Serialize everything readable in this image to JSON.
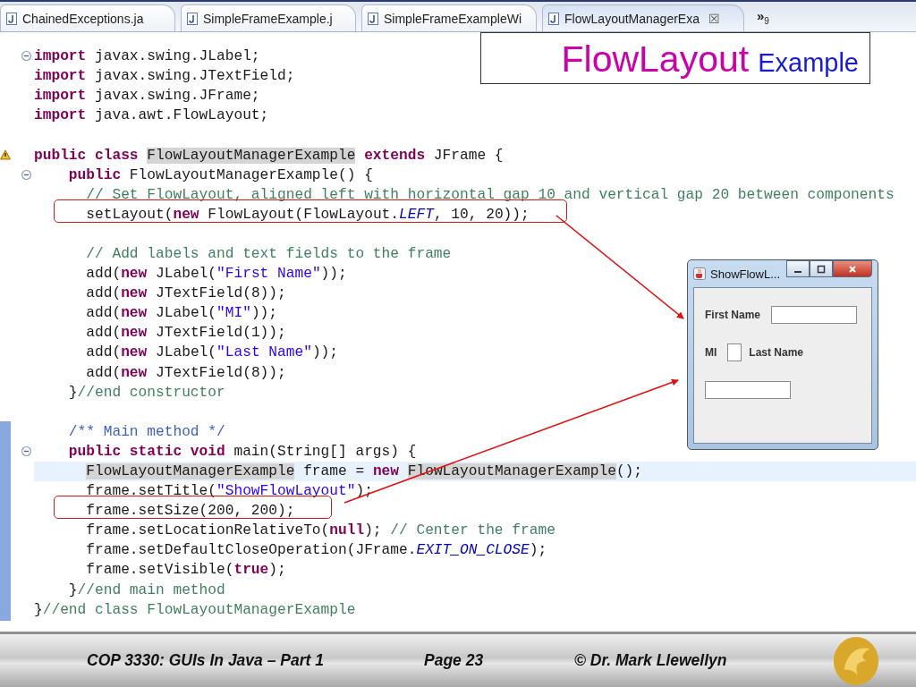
{
  "tabs": [
    {
      "label": "ChainedExceptions.ja",
      "selected": false
    },
    {
      "label": "SimpleFrameExample.j",
      "selected": false
    },
    {
      "label": "SimpleFrameExampleWi",
      "selected": false
    },
    {
      "label": "FlowLayoutManagerExa",
      "selected": true,
      "close": "☒"
    }
  ],
  "tab_overflow": {
    "symbol": "»",
    "count": "9"
  },
  "slide_title": {
    "main": "FlowLayout",
    "sub": "Example"
  },
  "code_lines": [
    {
      "kind": "code",
      "fold": true,
      "tokens": [
        {
          "kind": "keyword",
          "text": "import"
        },
        {
          "kind": "plain",
          "text": " javax.swing.JLabel;"
        }
      ]
    },
    {
      "kind": "code",
      "tokens": [
        {
          "kind": "keyword",
          "text": "import"
        },
        {
          "kind": "plain",
          "text": " javax.swing.JTextField;"
        }
      ]
    },
    {
      "kind": "code",
      "tokens": [
        {
          "kind": "keyword",
          "text": "import"
        },
        {
          "kind": "plain",
          "text": " javax.swing.JFrame;"
        }
      ]
    },
    {
      "kind": "code",
      "tokens": [
        {
          "kind": "keyword",
          "text": "import"
        },
        {
          "kind": "plain",
          "text": " java.awt.FlowLayout;"
        }
      ]
    },
    {
      "kind": "blank"
    },
    {
      "kind": "code",
      "warning": true,
      "tokens": [
        {
          "kind": "keyword",
          "text": "public class"
        },
        {
          "kind": "plain",
          "text": " FlowLayoutManagerExample",
          "marked": true
        },
        {
          "kind": "keyword",
          "text": " extends"
        },
        {
          "kind": "plain",
          "text": " JFrame {"
        }
      ]
    },
    {
      "kind": "code",
      "fold": true,
      "tokens": [
        {
          "kind": "keyword",
          "text": "    public"
        },
        {
          "kind": "plain",
          "text": " FlowLayoutManagerExample() {"
        }
      ]
    },
    {
      "kind": "code",
      "tokens": [
        {
          "kind": "comment",
          "text": "      // Set FlowLayout, aligned left with horizontal gap 10 and vertical gap 20 between components"
        }
      ]
    },
    {
      "kind": "code",
      "boxed": true,
      "tokens": [
        {
          "kind": "plain",
          "text": "      setLayout("
        },
        {
          "kind": "keyword",
          "text": "new"
        },
        {
          "kind": "plain",
          "text": " FlowLayout(FlowLayout."
        },
        {
          "kind": "constant",
          "text": "LEFT"
        },
        {
          "kind": "plain",
          "text": ", 10, 20));"
        }
      ]
    },
    {
      "kind": "blank"
    },
    {
      "kind": "code",
      "tokens": [
        {
          "kind": "comment",
          "text": "      // Add labels and text fields to the frame"
        }
      ]
    },
    {
      "kind": "code",
      "tokens": [
        {
          "kind": "plain",
          "text": "      add("
        },
        {
          "kind": "keyword",
          "text": "new"
        },
        {
          "kind": "plain",
          "text": " JLabel("
        },
        {
          "kind": "string",
          "text": "\"First Name\""
        },
        {
          "kind": "plain",
          "text": "));"
        }
      ]
    },
    {
      "kind": "code",
      "tokens": [
        {
          "kind": "plain",
          "text": "      add("
        },
        {
          "kind": "keyword",
          "text": "new"
        },
        {
          "kind": "plain",
          "text": " JTextField(8));"
        }
      ]
    },
    {
      "kind": "code",
      "tokens": [
        {
          "kind": "plain",
          "text": "      add("
        },
        {
          "kind": "keyword",
          "text": "new"
        },
        {
          "kind": "plain",
          "text": " JLabel("
        },
        {
          "kind": "string",
          "text": "\"MI\""
        },
        {
          "kind": "plain",
          "text": "));"
        }
      ]
    },
    {
      "kind": "code",
      "tokens": [
        {
          "kind": "plain",
          "text": "      add("
        },
        {
          "kind": "keyword",
          "text": "new"
        },
        {
          "kind": "plain",
          "text": " JTextField(1));"
        }
      ]
    },
    {
      "kind": "code",
      "tokens": [
        {
          "kind": "plain",
          "text": "      add("
        },
        {
          "kind": "keyword",
          "text": "new"
        },
        {
          "kind": "plain",
          "text": " JLabel("
        },
        {
          "kind": "string",
          "text": "\"Last Name\""
        },
        {
          "kind": "plain",
          "text": "));"
        }
      ]
    },
    {
      "kind": "code",
      "tokens": [
        {
          "kind": "plain",
          "text": "      add("
        },
        {
          "kind": "keyword",
          "text": "new"
        },
        {
          "kind": "plain",
          "text": " JTextField(8));"
        }
      ]
    },
    {
      "kind": "code",
      "tokens": [
        {
          "kind": "plain",
          "text": "    }"
        },
        {
          "kind": "comment",
          "text": "//end constructor"
        }
      ]
    },
    {
      "kind": "blank"
    },
    {
      "kind": "code",
      "changed": true,
      "tokens": [
        {
          "kind": "javadoc",
          "text": "    /** Main method */"
        }
      ]
    },
    {
      "kind": "code",
      "changed": true,
      "fold": true,
      "tokens": [
        {
          "kind": "keyword",
          "text": "    public static void"
        },
        {
          "kind": "plain",
          "text": " main(String[] args) {"
        }
      ]
    },
    {
      "kind": "code",
      "changed": true,
      "current": true,
      "tokens": [
        {
          "kind": "plain",
          "text": "      FlowLayoutManagerExample",
          "marked": true
        },
        {
          "kind": "plain",
          "text": " frame = "
        },
        {
          "kind": "keyword",
          "text": "new"
        },
        {
          "kind": "plain",
          "text": " FlowLayoutManagerExample",
          "marked": true
        },
        {
          "kind": "plain",
          "text": "();"
        }
      ]
    },
    {
      "kind": "code",
      "changed": true,
      "tokens": [
        {
          "kind": "plain",
          "text": "      frame.setTitle("
        },
        {
          "kind": "string",
          "text": "\"ShowFlowLayout\""
        },
        {
          "kind": "plain",
          "text": ");"
        }
      ]
    },
    {
      "kind": "code",
      "changed": true,
      "boxed": true,
      "tokens": [
        {
          "kind": "plain",
          "text": "      frame.setSize(200, 200);"
        }
      ]
    },
    {
      "kind": "code",
      "changed": true,
      "tokens": [
        {
          "kind": "plain",
          "text": "      frame.setLocationRelativeTo("
        },
        {
          "kind": "keyword",
          "text": "null"
        },
        {
          "kind": "plain",
          "text": "); "
        },
        {
          "kind": "comment",
          "text": "// Center the frame"
        }
      ]
    },
    {
      "kind": "code",
      "changed": true,
      "tokens": [
        {
          "kind": "plain",
          "text": "      frame.setDefaultCloseOperation(JFrame."
        },
        {
          "kind": "constant",
          "text": "EXIT_ON_CLOSE"
        },
        {
          "kind": "plain",
          "text": ");"
        }
      ]
    },
    {
      "kind": "code",
      "changed": true,
      "tokens": [
        {
          "kind": "plain",
          "text": "      frame.setVisible("
        },
        {
          "kind": "keyword",
          "text": "true"
        },
        {
          "kind": "plain",
          "text": ");"
        }
      ]
    },
    {
      "kind": "code",
      "changed": true,
      "tokens": [
        {
          "kind": "plain",
          "text": "    }"
        },
        {
          "kind": "comment",
          "text": "//end main method"
        }
      ]
    },
    {
      "kind": "code",
      "changed": true,
      "tokens": [
        {
          "kind": "plain",
          "text": "}"
        },
        {
          "kind": "comment",
          "text": "//end class FlowLayoutManagerExample"
        }
      ]
    }
  ],
  "demo_window": {
    "title": "ShowFlowL...",
    "labels": [
      "First Name",
      "MI",
      "Last Name"
    ]
  },
  "footer": {
    "course": "COP 3330:  GUIs In Java – Part 1",
    "page": "Page 23",
    "author": "© Dr. Mark Llewellyn"
  }
}
